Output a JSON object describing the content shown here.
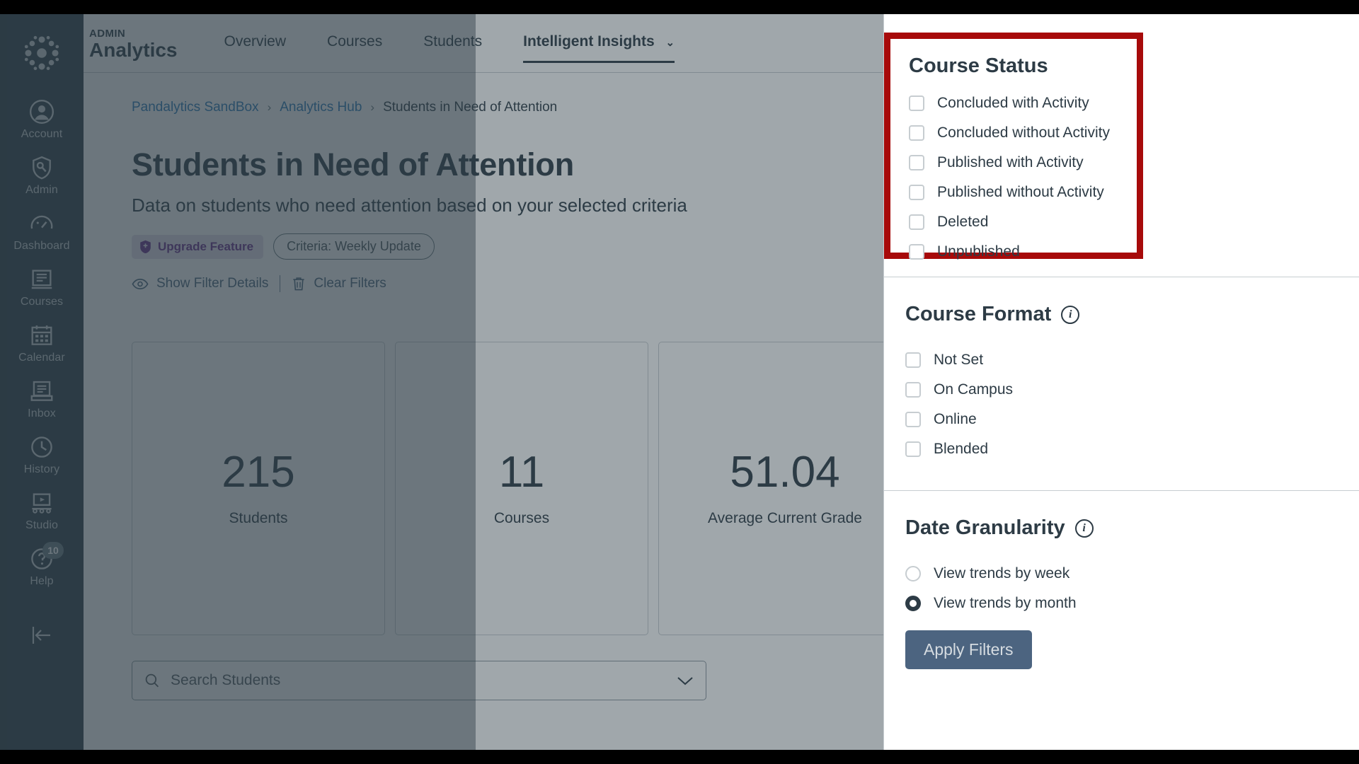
{
  "global_nav": {
    "logo_name": "canvas-logo",
    "items": [
      {
        "label": "Account",
        "icon": "user-circle-icon"
      },
      {
        "label": "Admin",
        "icon": "shield-wrench-icon"
      },
      {
        "label": "Dashboard",
        "icon": "gauge-icon"
      },
      {
        "label": "Courses",
        "icon": "book-icon"
      },
      {
        "label": "Calendar",
        "icon": "calendar-icon"
      },
      {
        "label": "Inbox",
        "icon": "inbox-icon"
      },
      {
        "label": "History",
        "icon": "clock-icon"
      },
      {
        "label": "Studio",
        "icon": "studio-icon"
      },
      {
        "label": "Help",
        "icon": "question-circle-icon",
        "badge": "10"
      }
    ],
    "collapse_icon": "collapse-left-icon"
  },
  "header": {
    "brand_eyebrow": "ADMIN",
    "brand_title": "Analytics",
    "nav": [
      {
        "label": "Overview",
        "active": false
      },
      {
        "label": "Courses",
        "active": false
      },
      {
        "label": "Students",
        "active": false
      },
      {
        "label": "Intelligent Insights",
        "active": true,
        "chevron": "⌄"
      }
    ]
  },
  "breadcrumb": {
    "items": [
      "Pandalytics SandBox",
      "Analytics Hub",
      "Students in Need of Attention"
    ],
    "separator": "›"
  },
  "page": {
    "title": "Students in Need of Attention",
    "subtitle": "Data on students who need attention based on your selected criteria",
    "upgrade_badge": "Upgrade Feature",
    "criteria_badge": "Criteria: Weekly Update",
    "show_filter_details": "Show Filter Details",
    "clear_filters": "Clear Filters"
  },
  "stats": [
    {
      "value": "215",
      "label": "Students"
    },
    {
      "value": "11",
      "label": "Courses"
    },
    {
      "value": "51.04",
      "label": "Average Current Grade"
    }
  ],
  "search": {
    "placeholder": "Search Students",
    "icon": "search-icon",
    "chevron": "chevron-down-icon"
  },
  "filter_tray": {
    "course_status": {
      "title": "Course Status",
      "options": [
        "Concluded with Activity",
        "Concluded without Activity",
        "Published with Activity",
        "Published without Activity",
        "Deleted",
        "Unpublished"
      ]
    },
    "course_format": {
      "title": "Course Format",
      "info_icon": "info-icon",
      "options": [
        "Not Set",
        "On Campus",
        "Online",
        "Blended"
      ]
    },
    "date_granularity": {
      "title": "Date Granularity",
      "info_icon": "info-icon",
      "options": [
        {
          "label": "View trends by week",
          "selected": false
        },
        {
          "label": "View trends by month",
          "selected": true
        }
      ]
    },
    "apply_label": "Apply Filters"
  },
  "colors": {
    "nav_bg": "#2D3B45",
    "link": "#2B7ABC",
    "highlight": "#A70A0A",
    "upgrade_purple": "#6B2E8C",
    "apply_btn": "#4C6480"
  }
}
